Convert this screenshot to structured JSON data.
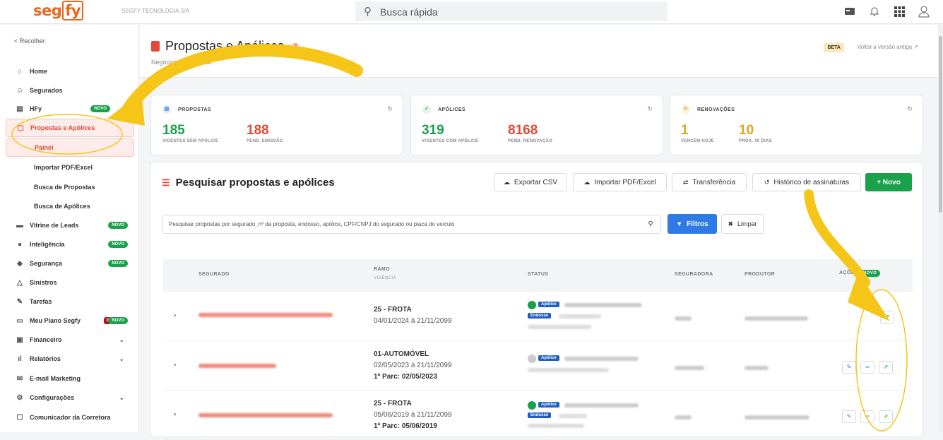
{
  "topbar": {
    "logo_left": "seg",
    "logo_right": "fy",
    "company": "SEGFY TECNOLOGIA S/A",
    "search_placeholder": "Busca rápida"
  },
  "sidebar": {
    "collapse": "< Recolher",
    "items": [
      {
        "label": "Home",
        "icon": "home-icon"
      },
      {
        "label": "Segurados",
        "icon": "users-icon"
      },
      {
        "label": "HFy",
        "icon": "doc-icon",
        "badge": "NOVO"
      },
      {
        "label": "Propostas e Apólices",
        "icon": "file-icon"
      },
      {
        "label": "Vitrine de Leads",
        "icon": "store-icon",
        "badge": "NOVO"
      },
      {
        "label": "Inteligência",
        "icon": "brain-icon",
        "badge": "NOVO"
      },
      {
        "label": "Segurança",
        "icon": "shield-icon",
        "badge": "NOVO"
      },
      {
        "label": "Sinistros",
        "icon": "warning-icon"
      },
      {
        "label": "Tarefas",
        "icon": "tasks-icon"
      },
      {
        "label": "Meu Plano Segfy",
        "icon": "plan-icon",
        "count": "0",
        "badge": "NOVO"
      },
      {
        "label": "Financeiro",
        "icon": "money-icon"
      },
      {
        "label": "Relatórios",
        "icon": "chart-icon"
      },
      {
        "label": "E-mail Marketing",
        "icon": "mail-icon"
      },
      {
        "label": "Configurações",
        "icon": "gear-icon"
      },
      {
        "label": "Comunicador da Corretora",
        "icon": "chat-icon"
      }
    ],
    "subitems": [
      "Painel",
      "Importar PDF/Excel",
      "Busca de Propostas",
      "Busca de Apólices"
    ]
  },
  "page": {
    "title": "Propostas e Apólices",
    "help": "?",
    "breadcrumb": "Negócios / Propostas",
    "beta": "BETA",
    "old_version": "Voltar a versão antiga ↗"
  },
  "cards": [
    {
      "title": "PROPOSTAS",
      "stats": [
        {
          "value": "185",
          "label": "VIGENTES SEM APÓLICE"
        },
        {
          "value": "188",
          "label": "PEND. EMISSÃO"
        }
      ]
    },
    {
      "title": "APÓLICES",
      "stats": [
        {
          "value": "319",
          "label": "VIGENTES COM APÓLICE"
        },
        {
          "value": "8168",
          "label": "PEND. RENOVAÇÃO"
        }
      ]
    },
    {
      "title": "RENOVAÇÕES",
      "stats": [
        {
          "value": "1",
          "label": "VENCEM HOJE"
        },
        {
          "value": "10",
          "label": "PRÓX. 30 DIAS"
        }
      ]
    }
  ],
  "panel": {
    "title": "Pesquisar propostas e apólices",
    "buttons": {
      "export": "Exportar CSV",
      "import": "Importar PDF/Excel",
      "transfer": "Transferência",
      "history": "Histórico de assinaturas",
      "new": "+ Novo"
    },
    "search_placeholder": "Pesquisar propostas por segurado, nº da proposta, endosso, apólice, CPF/CNPJ do segurado ou placa do veículo",
    "filters": "Filtros",
    "clear": "Limpar"
  },
  "table": {
    "headers": {
      "segurado": "SEGURADO",
      "ramo": "RAMO",
      "vigencia": "VIGÊNCIA",
      "status": "STATUS",
      "seguradora": "SEGURADORA",
      "produtor": "PRODUTOR",
      "acoes": "AÇÕES",
      "acoes_badge": "NOVO"
    },
    "rows": [
      {
        "ramo": "25 - FROTA",
        "vigencia": "04/01/2024 à 21/11/2099",
        "parcela": "",
        "tags": [
          "Apólice",
          "Endosso"
        ]
      },
      {
        "ramo": "01-AUTOMÓVEL",
        "vigencia": "02/05/2023 à 21/11/2099",
        "parcela": "1ª Parc: 02/05/2023",
        "tags": [
          "Apólice"
        ]
      },
      {
        "ramo": "25 - FROTA",
        "vigencia": "05/06/2019 à 21/11/2099",
        "parcela": "1ª Parc: 05/06/2019",
        "tags": [
          "Apólice",
          "Endosso"
        ]
      }
    ]
  },
  "colors": {
    "brand": "#e8671e",
    "red": "#e04a36",
    "green": "#1aa14c",
    "blue": "#2f7ae5",
    "annotation": "#f5c518"
  }
}
